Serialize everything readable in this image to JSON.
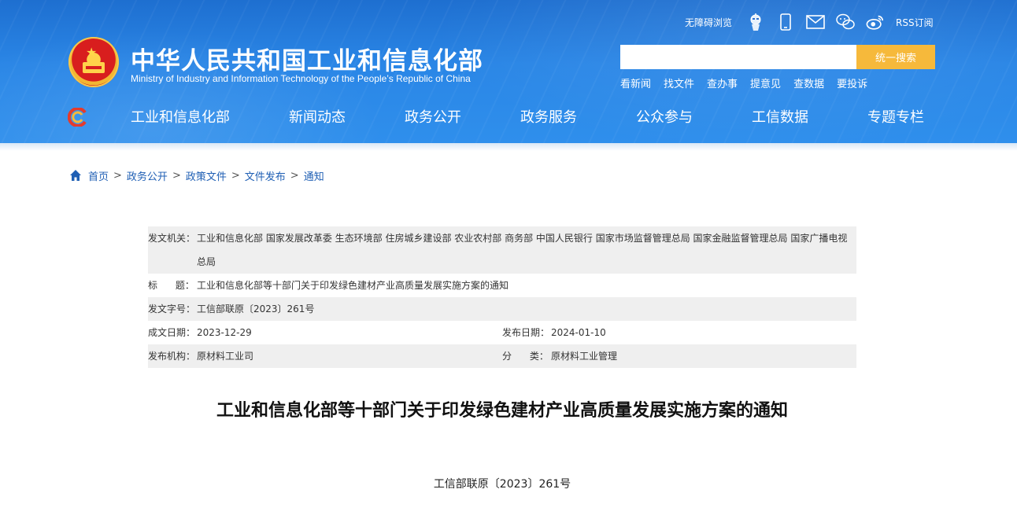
{
  "header": {
    "title": "中华人民共和国工业和信息化部",
    "subtitle": "Ministry of Industry and Information Technology of the People’s Republic of China",
    "tools": {
      "accessibility": "无障碍浏览",
      "rss": "RSS订阅",
      "icons": [
        "robot-icon",
        "mobile-icon",
        "mail-icon",
        "wechat-icon",
        "weibo-icon"
      ]
    },
    "search": {
      "placeholder": "",
      "button": "统一搜索"
    },
    "quick_links": [
      "看新闻",
      "找文件",
      "查办事",
      "提意见",
      "查数据",
      "要投诉"
    ],
    "nav": [
      "工业和信息化部",
      "新闻动态",
      "政务公开",
      "政务服务",
      "公众参与",
      "工信数据",
      "专题专栏"
    ]
  },
  "breadcrumb": [
    "首页",
    "政务公开",
    "政策文件",
    "文件发布",
    "通知"
  ],
  "meta": {
    "issuer_label": "发文机关：",
    "issuer_value": "工业和信息化部 国家发展改革委 生态环境部 住房城乡建设部 农业农村部 商务部 中国人民银行 国家市场监督管理总局 国家金融监督管理总局 国家广播电视总局",
    "title_label": "标      题：",
    "title_value": "工业和信息化部等十部门关于印发绿色建材产业高质量发展实施方案的通知",
    "docno_label": "发文字号：",
    "docno_value": "工信部联原〔2023〕261号",
    "created_label": "成文日期：",
    "created_value": "2023-12-29",
    "published_label": "发布日期：",
    "published_value": "2024-01-10",
    "org_label": "发布机构：",
    "org_value": "原材料工业司",
    "category_label": "分      类：",
    "category_value": "原材料工业管理"
  },
  "article": {
    "title": "工业和信息化部等十部门关于印发绿色建材产业高质量发展实施方案的通知",
    "doc_number": "工信部联原〔2023〕261号"
  },
  "colors": {
    "header_blue": "#2a86e6",
    "search_button": "#f6b93b",
    "breadcrumb_link": "#1f5fb4",
    "meta_shade": "#efefef"
  }
}
